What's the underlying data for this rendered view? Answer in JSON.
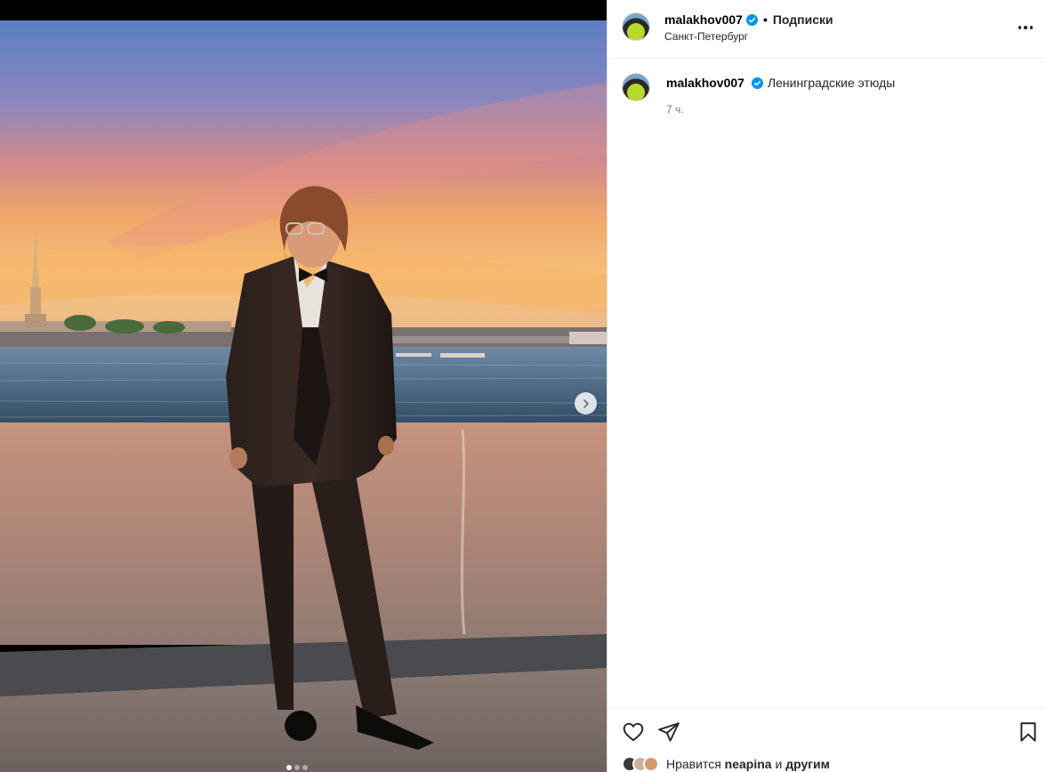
{
  "post": {
    "author": "malakhov007",
    "follow_label": "Подписки",
    "separator": "•",
    "location": "Санкт-Петербург",
    "caption": "Ленинградские этюды",
    "time_ago": "7 ч.",
    "likes_prefix": "Нравится",
    "likes_user": "neapina",
    "likes_conj": "и",
    "likes_suffix": "другим"
  },
  "carousel": {
    "slide_index": 1,
    "slide_count": 3
  },
  "icons": {
    "verified": "verified-badge-icon",
    "more": "more-options-icon",
    "next": "chevron-right-icon",
    "like": "heart-icon",
    "share": "paper-plane-icon",
    "save": "bookmark-icon"
  },
  "colors": {
    "verified": "#0095f6",
    "text": "#262626",
    "muted": "#737373"
  }
}
